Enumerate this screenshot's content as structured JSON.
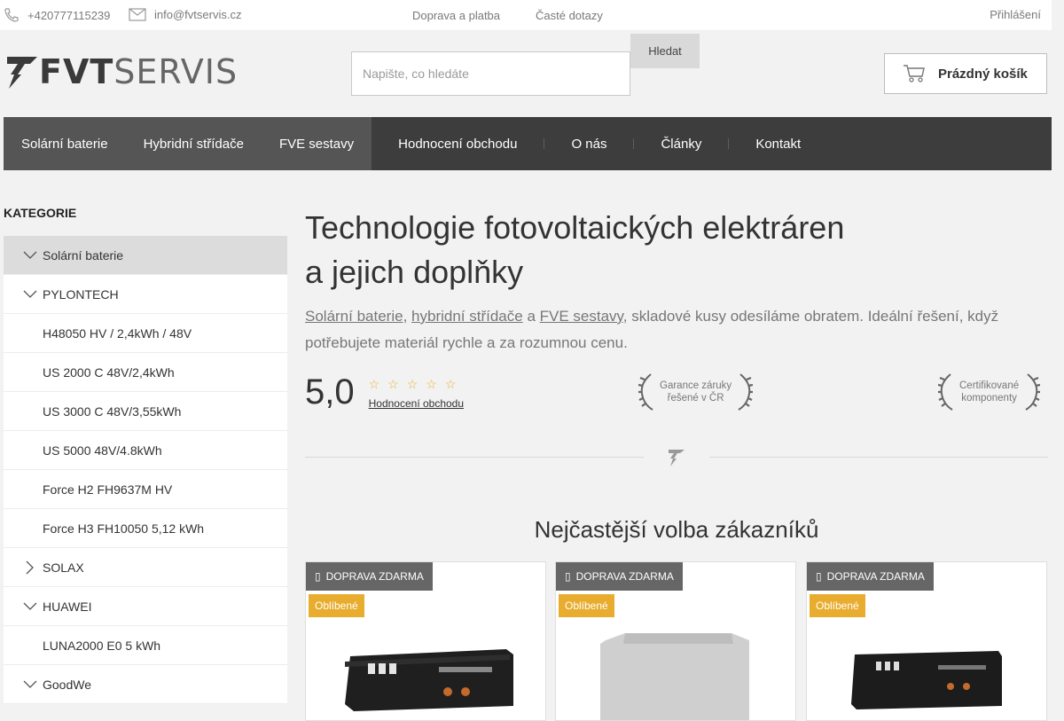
{
  "topbar": {
    "phone": "+420777115239",
    "email": "info@fvtservis.cz",
    "links": [
      "Doprava a platba",
      "Časté dotazy"
    ],
    "login": "Přihlášení"
  },
  "header": {
    "logo_part1": "FVT",
    "logo_part2": "SERVIS",
    "search_placeholder": "Napište, co hledáte",
    "search_button": "Hledat",
    "cart_label": "Prázdný košík"
  },
  "nav": {
    "items": [
      "Solární baterie",
      "Hybridní střídače",
      "FVE sestavy",
      "Hodnocení obchodu",
      "O nás",
      "Články",
      "Kontakt"
    ]
  },
  "sidebar": {
    "title": "KATEGORIE",
    "items": [
      {
        "label": "Solární baterie",
        "icon": "chevron-down-icon"
      },
      {
        "label": "PYLONTECH",
        "icon": "chevron-down-icon"
      },
      {
        "label": "H48050 HV / 2,4kWh / 48V",
        "icon": ""
      },
      {
        "label": "US 2000 C 48V/2,4kWh",
        "icon": ""
      },
      {
        "label": "US 3000 C 48V/3,55kWh",
        "icon": ""
      },
      {
        "label": "US 5000 48V/4.8kWh",
        "icon": ""
      },
      {
        "label": "Force H2 FH9637M HV",
        "icon": ""
      },
      {
        "label": "Force H3 FH10050 5,12 kWh",
        "icon": ""
      },
      {
        "label": "SOLAX",
        "icon": "chevron-right-icon"
      },
      {
        "label": "HUAWEI",
        "icon": "chevron-down-icon"
      },
      {
        "label": "LUNA2000 E0 5 kWh",
        "icon": ""
      },
      {
        "label": "GoodWe",
        "icon": "chevron-down-icon"
      }
    ]
  },
  "hero": {
    "title_line1": "Technologie fotovoltaických elektráren",
    "title_line2": "a jejich doplňky",
    "desc_link1": "Solární baterie",
    "desc_sep1": ", ",
    "desc_link2": "hybridní střídače",
    "desc_sep2": " a ",
    "desc_link3": "FVE sestavy",
    "desc_rest": ", skladové kusy odesíláme obratem. Ideální řešení, když potřebujete materiál rychle a za rozumnou cenu.",
    "rating_score": "5,0",
    "rating_stars": 5,
    "rating_link": "Hodnocení obchodu",
    "badge1_line1": "Garance záruky",
    "badge1_line2": "řešené v ČR",
    "badge2_line1": "Certifikované",
    "badge2_line2": "komponenty"
  },
  "section": {
    "title": "Nejčastější volba zákazníků"
  },
  "products": [
    {
      "ship": "DOPRAVA ZDARMA",
      "tag": "Oblíbené"
    },
    {
      "ship": "DOPRAVA ZDARMA",
      "tag": "Oblíbené"
    },
    {
      "ship": "DOPRAVA ZDARMA",
      "tag": "Oblíbené"
    }
  ],
  "colors": {
    "nav_bg": "#3d3d3d",
    "nav_active_bg": "#555555",
    "accent_tag": "#e8ac2e",
    "star": "#e8b431"
  }
}
